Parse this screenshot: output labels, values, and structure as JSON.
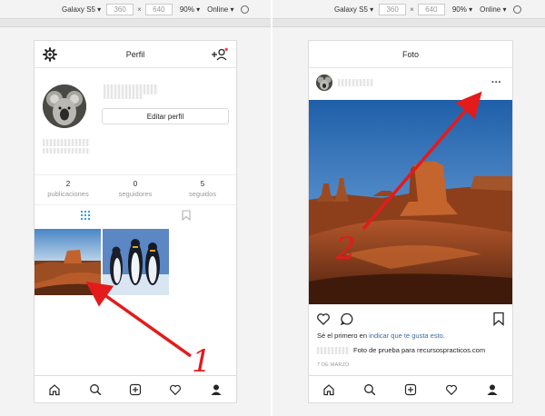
{
  "devtools": [
    {
      "device": "Galaxy S5",
      "width": "360",
      "height": "640",
      "zoom": "90%",
      "network": "Online"
    },
    {
      "device": "Galaxy S5",
      "width": "360",
      "height": "640",
      "zoom": "90%",
      "network": "Online"
    }
  ],
  "profile": {
    "title": "Perfil",
    "edit_label": "Editar perfil",
    "stats": [
      {
        "value": "2",
        "label": "publicaciones"
      },
      {
        "value": "0",
        "label": "seguidores"
      },
      {
        "value": "5",
        "label": "seguidos"
      }
    ]
  },
  "post": {
    "title": "Foto",
    "likes_prefix": "Sé el primero en ",
    "likes_link": "indicar que te gusta esto",
    "likes_suffix": ".",
    "caption": "Foto de prueba para recursospracticos.com",
    "date": "7 DE MARZO"
  },
  "annotations": {
    "step1": "1",
    "step2": "2",
    "arrow_color": "#e31b1b"
  },
  "icons": [
    "gear-icon",
    "add-user-icon",
    "grid-icon",
    "bookmark-icon",
    "home-icon",
    "search-icon",
    "add-post-icon",
    "heart-icon",
    "profile-icon",
    "comment-icon",
    "more-options-icon",
    "dropdown-icon",
    "rotate-icon"
  ]
}
